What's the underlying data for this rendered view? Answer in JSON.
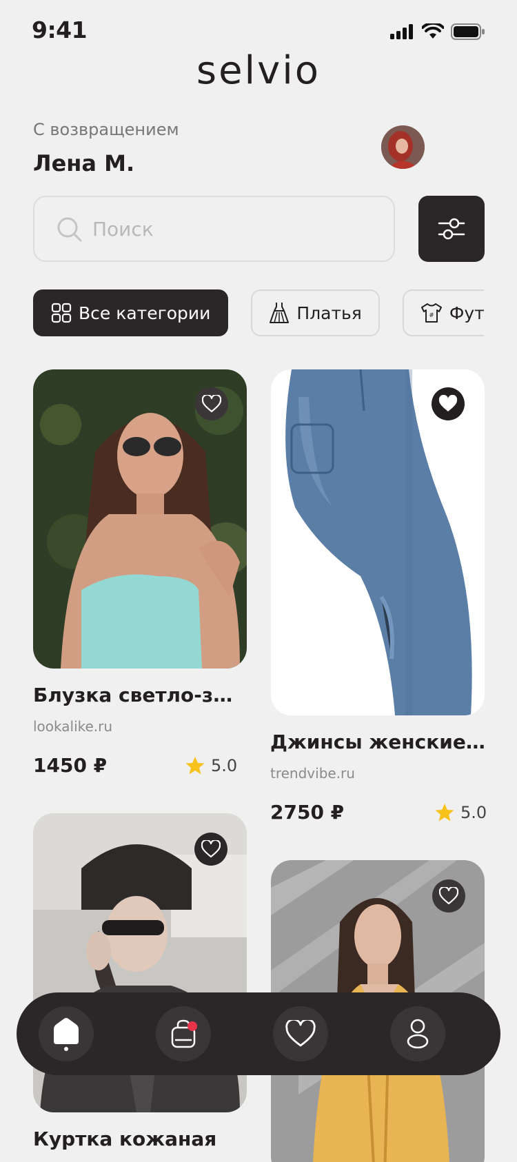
{
  "status": {
    "time": "9:41"
  },
  "app": {
    "logo": "selvio"
  },
  "greeting": {
    "subtitle": "С возвращением",
    "name": "Лена М."
  },
  "search": {
    "placeholder": "Поиск"
  },
  "categories": [
    {
      "label": "Все категории",
      "icon": "grid-icon",
      "active": true
    },
    {
      "label": "Платья",
      "icon": "dress-icon",
      "active": false
    },
    {
      "label": "Футболки",
      "icon": "tshirt-icon",
      "active": false
    }
  ],
  "products": [
    {
      "title": "Блузка светло-зел...",
      "shop": "lookalike.ru",
      "price": "1450 ₽",
      "rating": "5.0",
      "favorite": false
    },
    {
      "title": "Джинсы женские в ...",
      "shop": "trendvibe.ru",
      "price": "2750 ₽",
      "rating": "5.0",
      "favorite": true
    },
    {
      "title": "Куртка кожаная",
      "shop": "",
      "price": "",
      "rating": "",
      "favorite": false
    },
    {
      "title": "",
      "shop": "",
      "price": "",
      "rating": "",
      "favorite": false
    }
  ],
  "nav": [
    {
      "icon": "home-icon",
      "active": true
    },
    {
      "icon": "bag-icon",
      "badge": true
    },
    {
      "icon": "heart-icon"
    },
    {
      "icon": "profile-icon"
    }
  ],
  "colors": {
    "dark": "#2b2728",
    "background": "#f0f0f0",
    "star": "#f6c21b",
    "badge": "#e8344a"
  }
}
